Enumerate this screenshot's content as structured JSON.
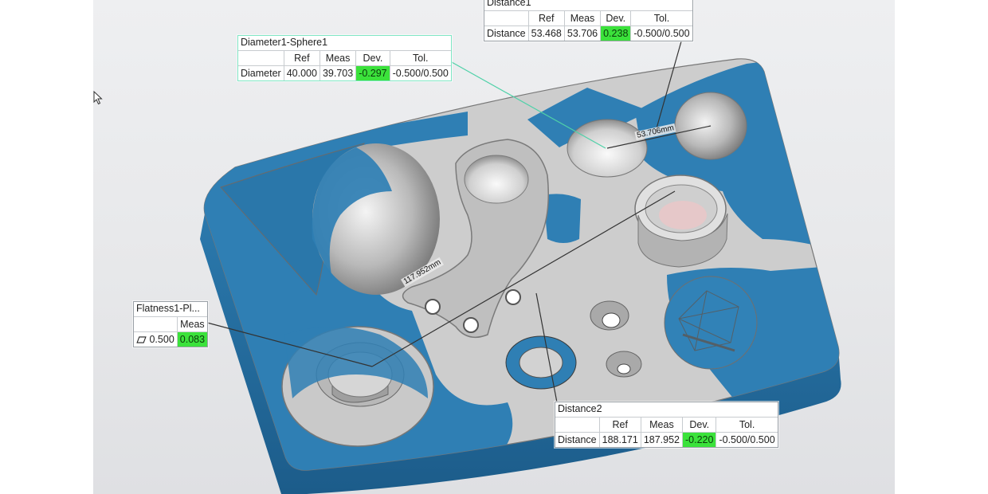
{
  "viewport": {
    "background": "#e9eaec",
    "model_colors": {
      "mesh": "#2f7fb4",
      "cad": "#c9c9c9",
      "edge": "#6d6d6d"
    }
  },
  "dimension_tags": [
    {
      "text": "53.706mm"
    },
    {
      "text": "117.952mm"
    }
  ],
  "labels": {
    "diameter": {
      "title": "Diameter1-Sphere1",
      "headers": [
        "Ref",
        "Meas",
        "Dev.",
        "Tol."
      ],
      "row": {
        "name": "Diameter",
        "ref": "40.000",
        "meas": "39.703",
        "dev": "-0.297",
        "tol": "-0.500/0.500"
      }
    },
    "distance1": {
      "title": "Distance1",
      "headers": [
        "Ref",
        "Meas",
        "Dev.",
        "Tol."
      ],
      "row": {
        "name": "Distance",
        "ref": "53.468",
        "meas": "53.706",
        "dev": "0.238",
        "tol": "-0.500/0.500"
      }
    },
    "flatness": {
      "title": "Flatness1-Pl...",
      "headers": [
        "Meas"
      ],
      "row": {
        "tol": "0.500",
        "meas": "0.083"
      },
      "icon": "parallelogram-flatness-icon"
    },
    "distance2": {
      "title": "Distance2",
      "headers": [
        "Ref",
        "Meas",
        "Dev.",
        "Tol."
      ],
      "row": {
        "name": "Distance",
        "ref": "188.171",
        "meas": "187.952",
        "dev": "-0.220",
        "tol": "-0.500/0.500"
      }
    }
  },
  "status_colors": {
    "in_tolerance": "#3be23b"
  },
  "cursor_icon": "arrow-cursor-icon"
}
